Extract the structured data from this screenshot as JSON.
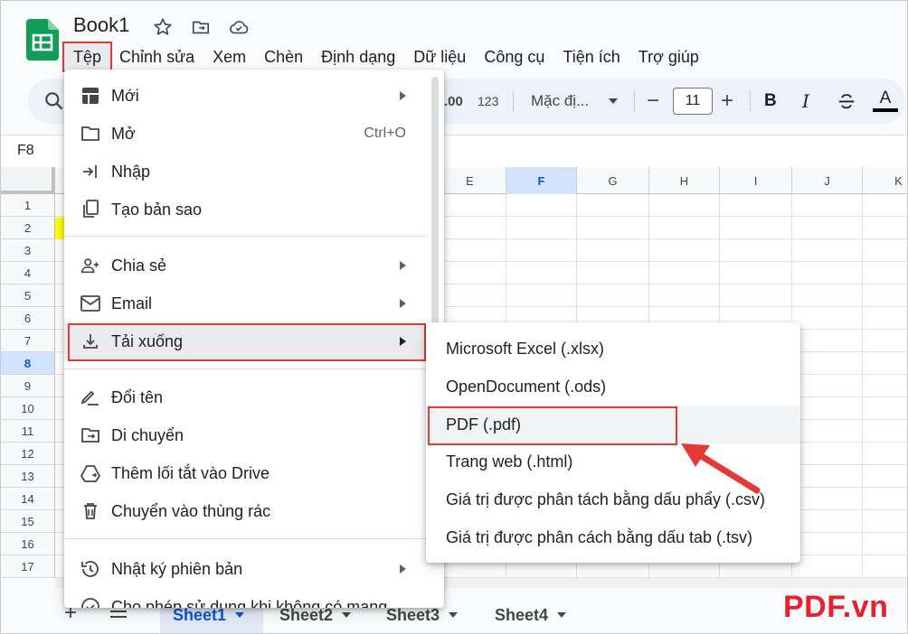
{
  "header": {
    "doc_title": "Book1"
  },
  "menubar": {
    "items": [
      "Tệp",
      "Chỉnh sửa",
      "Xem",
      "Chèn",
      "Định dạng",
      "Dữ liệu",
      "Công cụ",
      "Tiện ích",
      "Trợ giúp"
    ],
    "active_index": 0
  },
  "toolbar": {
    "number_format_decimal": ".00",
    "number_format_123": "123",
    "font_name": "Mặc đị...",
    "font_size": "11",
    "minus": "−",
    "plus": "+",
    "bold": "B",
    "italic": "I",
    "text_color": "A"
  },
  "formula_bar": {
    "cell_ref": "F8"
  },
  "grid": {
    "columns": [
      "E",
      "F",
      "G",
      "H",
      "I",
      "J",
      "K"
    ],
    "selected_column": "F",
    "rows": [
      "1",
      "2",
      "3",
      "4",
      "5",
      "6",
      "7",
      "8",
      "9",
      "10",
      "11",
      "12",
      "13",
      "14",
      "15",
      "16",
      "17"
    ],
    "selected_row": "8"
  },
  "file_menu": {
    "items": [
      {
        "label": "Mới",
        "icon": "new-sheet-icon",
        "submenu": true
      },
      {
        "label": "Mở",
        "icon": "folder-icon",
        "shortcut": "Ctrl+O"
      },
      {
        "label": "Nhập",
        "icon": "import-icon"
      },
      {
        "label": "Tạo bản sao",
        "icon": "copy-icon"
      },
      {
        "label": "Chia sẻ",
        "icon": "share-icon",
        "submenu": true
      },
      {
        "label": "Email",
        "icon": "email-icon",
        "submenu": true
      },
      {
        "label": "Tải xuống",
        "icon": "download-icon",
        "submenu": true,
        "highlighted": true
      },
      {
        "label": "Đổi tên",
        "icon": "rename-icon"
      },
      {
        "label": "Di chuyển",
        "icon": "move-folder-icon"
      },
      {
        "label": "Thêm lối tắt vào Drive",
        "icon": "drive-shortcut-icon"
      },
      {
        "label": "Chuyển vào thùng rác",
        "icon": "trash-icon"
      },
      {
        "label": "Nhật ký phiên bản",
        "icon": "history-icon",
        "submenu": true
      },
      {
        "label": "Cho phép sử dụng khi không có mạng",
        "icon": "offline-icon"
      }
    ]
  },
  "download_submenu": {
    "items": [
      "Microsoft Excel (.xlsx)",
      "OpenDocument (.ods)",
      "PDF (.pdf)",
      "Trang web (.html)",
      "Giá trị được phân tách bằng dấu phẩy (.csv)",
      "Giá trị được phân cách bằng dấu tab (.tsv)"
    ],
    "highlighted_index": 2
  },
  "sheets": {
    "tabs": [
      "Sheet1",
      "Sheet2",
      "Sheet3",
      "Sheet4"
    ],
    "active_index": 0,
    "add_label": "+"
  },
  "watermark": "PDF.vn",
  "colors": {
    "accent": "#0b57d0",
    "highlight_box": "#e53935",
    "sheets_green": "#0f9d58",
    "watermark": "#e8212d"
  }
}
